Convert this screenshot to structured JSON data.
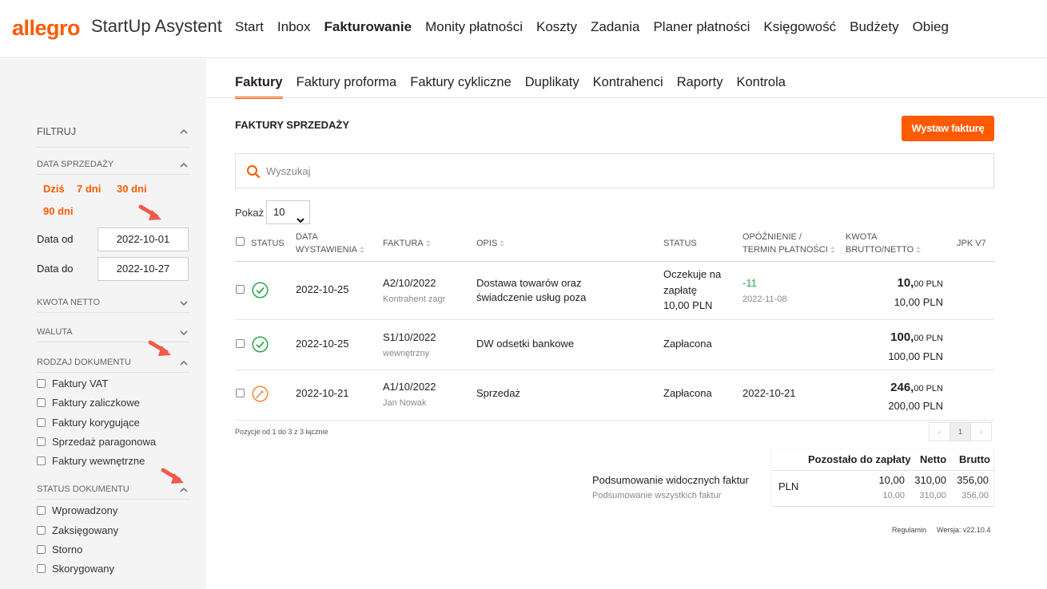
{
  "app": {
    "logo": "allegro",
    "product": "StartUp Asystent"
  },
  "colors": {
    "accent": "#ff5a00",
    "ok": "#2da44e",
    "sidebar_bg": "#f4f4f4"
  },
  "nav": {
    "items": [
      "Start",
      "Inbox",
      "Fakturowanie",
      "Monity płatności",
      "Koszty",
      "Zadania",
      "Planer płatności",
      "Księgowość",
      "Budżety",
      "Obieg"
    ],
    "active": "Fakturowanie"
  },
  "subtabs": {
    "items": [
      "Faktury",
      "Faktury proforma",
      "Faktury cykliczne",
      "Duplikaty",
      "Kontrahenci",
      "Raporty",
      "Kontrola"
    ],
    "active": "Faktury"
  },
  "sidebar": {
    "filter_title": "FILTRUJ",
    "date_section": "DATA SPRZEDAŻY",
    "ranges": [
      "Dziś",
      "7 dni",
      "30 dni",
      "90 dni"
    ],
    "date_from_label": "Data od",
    "date_from": "2022-10-01",
    "date_to_label": "Data do",
    "date_to": "2022-10-27",
    "amount_section": "KWOTA NETTO",
    "currency_section": "WALUTA",
    "doctype_section": "RODZAJ DOKUMENTU",
    "doctypes": [
      "Faktury VAT",
      "Faktury zaliczkowe",
      "Faktury korygujące",
      "Sprzedaż paragonowa",
      "Faktury wewnętrzne"
    ],
    "status_section": "STATUS DOKUMENTU",
    "statuses": [
      "Wprowadzony",
      "Zaksięgowany",
      "Storno",
      "Skorygowany"
    ]
  },
  "main": {
    "title": "FAKTURY SPRZEDAŻY",
    "issue_button": "Wystaw fakturę",
    "search_placeholder": "Wyszukaj",
    "show_label": "Pokaż",
    "show_value": "10",
    "columns": {
      "status": "STATUS",
      "date_1": "DATA",
      "date_2": "WYSTAWIENIA",
      "invoice": "FAKTURA",
      "desc": "OPIS",
      "state": "STATUS",
      "delay_1": "OPÓŹNIENIE /",
      "delay_2": "TERMIN PŁATNOŚCI",
      "amount_1": "KWOTA",
      "amount_2": "BRUTTO/NETTO",
      "jpk": "JPK V7"
    },
    "rows": [
      {
        "date": "2022-10-25",
        "invoice": "A2/10/2022",
        "party": "Kontrahent zagr",
        "desc_1": "Dostawa towarów oraz",
        "desc_2": "świadczenie usług poza",
        "state_1": "Oczekuje na",
        "state_2": "zapłatę",
        "state_3": "10,00 PLN",
        "delay": "-11",
        "due": "2022-11-08",
        "gross_int": "10,",
        "gross_dec": "00",
        "currency": "PLN",
        "net": "10,00 PLN",
        "icon": "check-circle-icon"
      },
      {
        "date": "2022-10-25",
        "invoice": "S1/10/2022",
        "party": "wewnętrzny",
        "desc_1": "DW odsetki bankowe",
        "state_1": "Zapłacona",
        "gross_int": "100,",
        "gross_dec": "00",
        "currency": "PLN",
        "net": "100,00 PLN",
        "icon": "check-circle-icon"
      },
      {
        "date": "2022-10-21",
        "invoice": "A1/10/2022",
        "party": "Jan Nowak",
        "desc_1": "Sprzedaż",
        "state_1": "Zapłacona",
        "delay": "2022-10-21",
        "gross_int": "246,",
        "gross_dec": "00",
        "currency": "PLN",
        "net": "200,00 PLN",
        "icon": "pencil-circle-icon"
      }
    ],
    "footnote": "Pozycje od 1 do 3 z 3 łącznie",
    "pager": {
      "prev": "‹",
      "page": "1",
      "next": "›"
    }
  },
  "summary": {
    "visible_label": "Podsumowanie widocznych faktur",
    "all_label": "Podsumowanie wszystkich faktur",
    "h_remaining": "Pozostało do zapłaty",
    "h_net": "Netto",
    "h_gross": "Brutto",
    "currency": "PLN",
    "visible": {
      "remaining": "10,00",
      "net": "310,00",
      "gross": "356,00"
    },
    "all": {
      "remaining": "10,00",
      "net": "310,00",
      "gross": "356,00"
    }
  },
  "footer": {
    "terms": "Regulamin",
    "version": "Wersja: v22.10.4"
  }
}
